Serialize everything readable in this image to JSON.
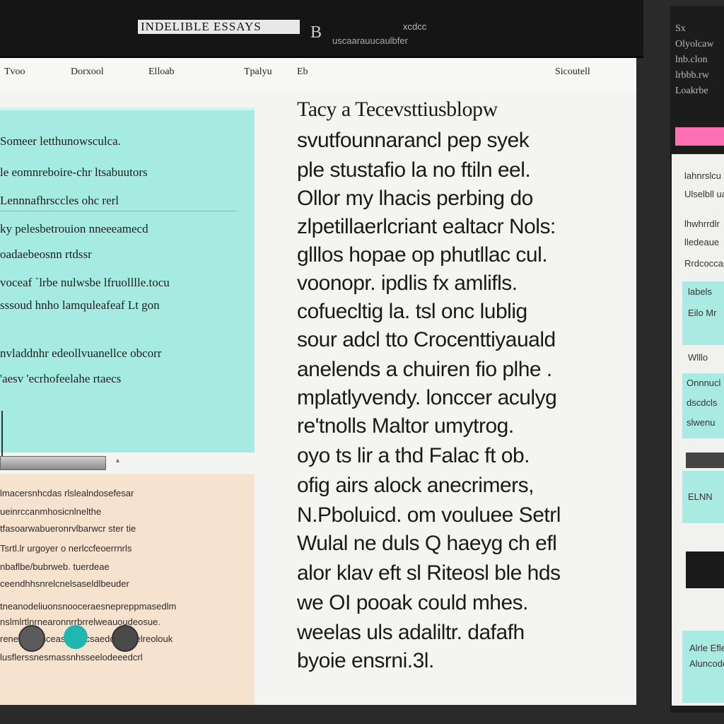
{
  "app": {
    "title": "INDELIBLE ESSAYS",
    "badge": "B",
    "subtitle_1": "xcdcc",
    "subtitle_2": "uscaarauucaulbfer"
  },
  "menubar": {
    "items": [
      "Tvoo",
      "Dorxool",
      "Elloab",
      "Tpalyu",
      "Eb",
      "Sicoutell"
    ]
  },
  "left_teal_pane": {
    "lines": [
      "Someer letthunowsculca.",
      "le eomnreboire-chr ltsabuutors",
      "Lennnafhrsccles ohc rerl",
      "ky pelesbetrouion nneeeamecd",
      "oadaebeosnn rtdssr",
      "voceaf `lrbe nulwsbe lfruolllle.tocu",
      "sssoud hnho lamquleafeaf Lt gon",
      "nvladdnhr edeollvuanellce obcorr",
      "'aesv 'ecrhofeelahe rtaecs"
    ]
  },
  "left_peach_pane": {
    "lines": [
      "lmacersnhcdas rlslealndosefesar",
      "ueinrccanmhosicnlnelthe",
      "tfasoarwabueronrvlbarwcr ster tie",
      "Tsrtl.lr urgoyer o nerlccfeoerrnrls",
      "nbaflbe/bubrweb. tuerdeae",
      "ceendhhsnrelcnelsaseldlbeuder",
      "tneanodeliuonsnooceraesnepreppmasedlm",
      "nslmlrtlnrnearonnrrbrrelweauoudeosue.",
      "reneosebrsceasaeclrcsaedoundeelreolouk",
      "lusflerssnesmassnhsseelodeeedcrl"
    ]
  },
  "article": {
    "lines": [
      "Tacy a Tecevsttiusblopw",
      "svutfounnarancl pep syek",
      "ple stustafio la no ftiln eel.",
      "Ollor my lhacis perbing do",
      "zlpetillaerlcriant ealtacr Nols:",
      "glllos hopae op phutllac cul.",
      "voonopr. ipdlis fx amlifls.",
      "cofuecltig la. tsl onc lublig",
      "sour adcl tto Crocenttiyauald",
      "anelends a chuiren fio plhe .",
      "mplatlyvendy. lonccer aculyg",
      "re'tnolls Maltor umytrog.",
      "oyo ts lir a thd Falac ft ob.",
      "ofig airs alock anecrimers,",
      "N.Pboluicd. om vouluee Setrl",
      "Wulal ne duls Q haeyg ch efl",
      "alor klav eft sl Riteosl ble hds",
      "we OI pooak could mhes.",
      "weelas uls adaliltr. dafafh",
      "byoie ensrni.3l."
    ]
  },
  "side_panel": {
    "top_text": [
      "Sx",
      "Olyolcaw",
      "lnb.clon",
      "lrbbb.rw",
      "Loakrbe"
    ],
    "list_text": [
      "lahnrslcu",
      "Ulselbll ua",
      "lhwhrrdlr",
      "lledeaue",
      "Rrdcoccaslsl"
    ],
    "cards": [
      "labels",
      "Eilo Mr",
      "Wlllo",
      "Onnnucl",
      "dscdcls",
      "slwenu",
      "ELNN",
      "Alrle Eflee",
      "Aluncodere"
    ]
  },
  "colors": {
    "teal_pane": "#a6ebe2",
    "peach_pane": "#f6e3cf",
    "pink_bar": "#ff6fb3",
    "dot_1": "#5b5b5b",
    "dot_2": "#1fb7b0",
    "dot_3": "#4a4a4a"
  }
}
